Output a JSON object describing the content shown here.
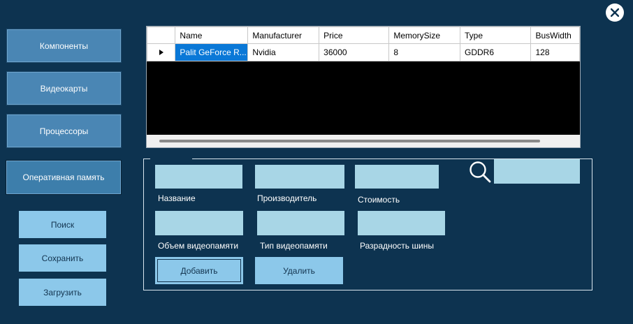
{
  "nav": {
    "components": "Компоненты",
    "gpus": "Видеокарты",
    "cpus": "Процессоры",
    "ram": "Оперативная память"
  },
  "actions": {
    "search": "Поиск",
    "save": "Сохранить",
    "load": "Загрузить"
  },
  "grid": {
    "columns": [
      "Name",
      "Manufacturer",
      "Price",
      "MemorySize",
      "Type",
      "BusWidth"
    ],
    "rows": [
      {
        "name": "Palit GeForce R...",
        "manufacturer": "Nvidia",
        "price": "36000",
        "memory_size": "8",
        "type": "GDDR6",
        "bus_width": "128"
      }
    ]
  },
  "form": {
    "name_label": "Название",
    "manufacturer_label": "Производитель",
    "price_label": "Стоимость",
    "memory_label": "Объем видеопамяти",
    "memtype_label": "Тип видеопамяти",
    "buswidth_label": "Разрадность шины",
    "add": "Добавить",
    "delete": "Удалить"
  },
  "colors": {
    "background": "#0d3350",
    "nav_button": "#4a86b4",
    "action_button": "#8cc8ea",
    "field": "#a8d6e6",
    "selection": "#0a78d7"
  }
}
